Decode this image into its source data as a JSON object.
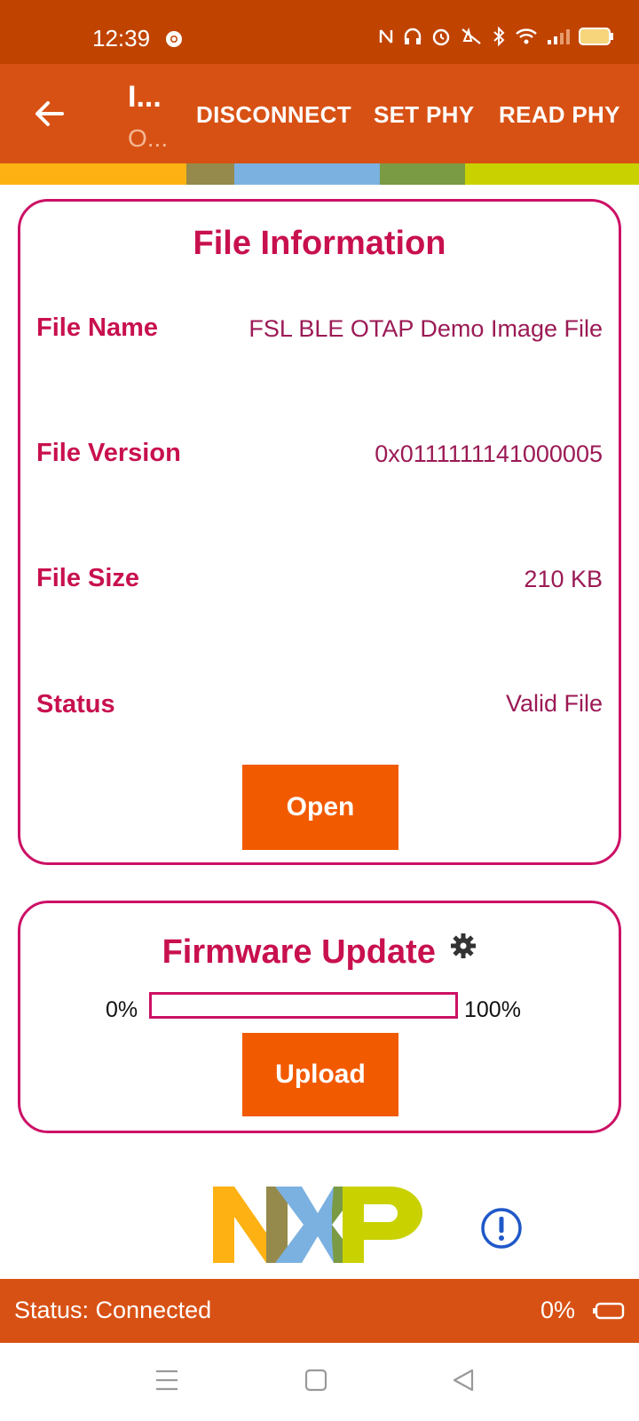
{
  "status_bar": {
    "time": "12:39",
    "icons": [
      "chrome-icon",
      "nfc-icon",
      "headset-icon",
      "alarm-icon",
      "mute-icon",
      "bluetooth-icon",
      "wifi-icon",
      "signal-icon",
      "battery-icon"
    ]
  },
  "app_bar": {
    "title": "I...",
    "subtitle": "O...",
    "actions": [
      "DISCONNECT",
      "SET PHY",
      "READ PHY"
    ]
  },
  "stripe_colors": [
    "#fdb112",
    "#958a4c",
    "#7bb1e0",
    "#7a9a43",
    "#c9d200"
  ],
  "file_info": {
    "title": "File Information",
    "rows": [
      {
        "label": "File Name",
        "value": "FSL BLE OTAP Demo Image File"
      },
      {
        "label": "File Version",
        "value": "0x0111111141000005"
      },
      {
        "label": "File Size",
        "value": "210 KB"
      },
      {
        "label": "Status",
        "value": "Valid File"
      }
    ],
    "button": "Open"
  },
  "firmware": {
    "title": "Firmware Update",
    "min_label": "0%",
    "max_label": "100%",
    "progress": 0,
    "button": "Upload"
  },
  "bottom_bar": {
    "status": "Status: Connected",
    "percent": "0%"
  },
  "colors": {
    "status_bar": "#c04400",
    "app_bar": "#d85114",
    "accent": "#cc1166",
    "button": "#f25a00"
  }
}
